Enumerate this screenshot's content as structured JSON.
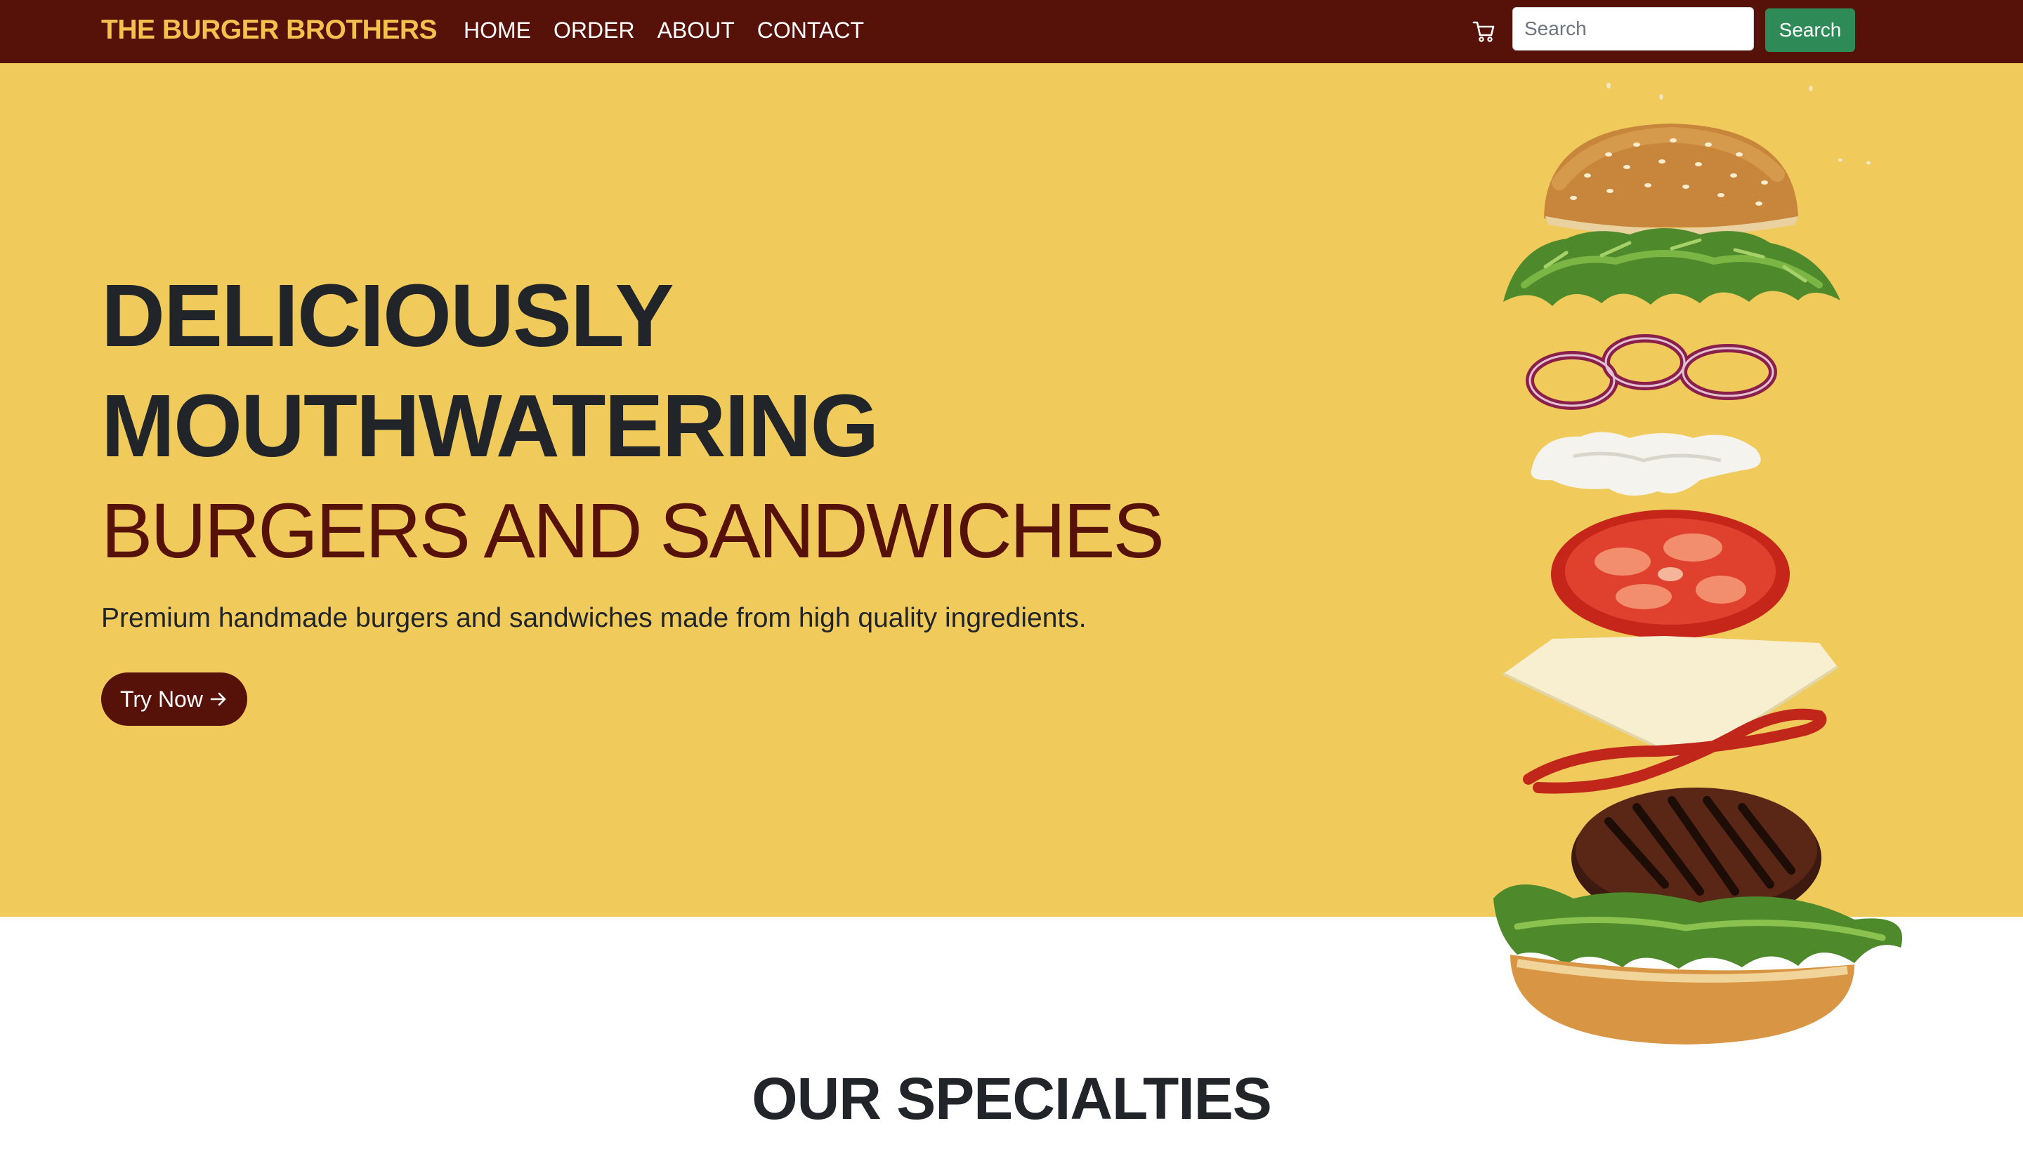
{
  "navbar": {
    "brand": "THE BURGER BROTHERS",
    "links": [
      {
        "label": "HOME"
      },
      {
        "label": "ORDER"
      },
      {
        "label": "ABOUT"
      },
      {
        "label": "CONTACT"
      }
    ],
    "cart_icon": "cart-icon",
    "search": {
      "placeholder": "Search",
      "value": "",
      "button_label": "Search"
    }
  },
  "hero": {
    "line1": "DELICIOUSLY",
    "line2": "MOUTHWATERING",
    "line3": "BURGERS AND SANDWICHES",
    "description": "Premium handmade burgers and sandwiches made from high quality ingredients.",
    "cta_label": "Try Now",
    "cta_icon": "arrow-right-icon",
    "image_icon": "exploded-burger-illustration"
  },
  "specialties": {
    "title": "OUR SPECIALTIES"
  },
  "colors": {
    "navbar_bg": "#561109",
    "brand": "#f2c14e",
    "hero_bg": "#f0cb5c",
    "heading_dark": "#212529",
    "heading_accent": "#561109",
    "search_button": "#2e8b57"
  }
}
